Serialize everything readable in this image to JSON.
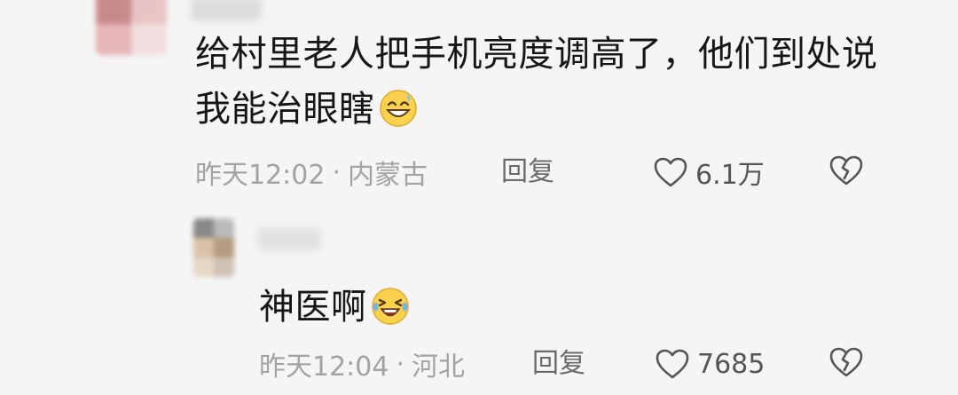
{
  "comments": [
    {
      "text_lines": [
        "给村里老人把手机亮度调高了，他们到处说",
        "我能治眼瞎"
      ],
      "emoji": "grinning-sweat-emoji",
      "time": "昨天12:02",
      "location": "内蒙古",
      "reply_label": "回复",
      "likes": "6.1万"
    },
    {
      "text_lines": [
        "神医啊"
      ],
      "emoji": "laughing-crying-emoji",
      "time": "昨天12:04",
      "location": "河北",
      "reply_label": "回复",
      "likes": "7685"
    }
  ],
  "meta_separator": "·",
  "icons": {
    "like": "heart-outline-icon",
    "dislike": "broken-heart-icon"
  },
  "colors": {
    "background": "#f5f5f5",
    "meta_text": "#a3a3a3",
    "reply_text": "#6a6a6a",
    "icon_stroke": "#555555"
  }
}
